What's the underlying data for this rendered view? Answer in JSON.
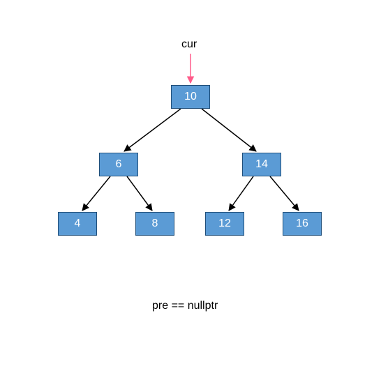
{
  "labels": {
    "cur": "cur",
    "pre": "pre == nullptr"
  },
  "nodes": {
    "root": "10",
    "l": "6",
    "r": "14",
    "ll": "4",
    "lr": "8",
    "rl": "12",
    "rr": "16"
  },
  "chart_data": {
    "type": "tree",
    "title": "",
    "pointer_label": "cur",
    "status_text": "pre == nullptr",
    "nodes": [
      {
        "id": "n10",
        "value": 10,
        "children": [
          "n6",
          "n14"
        ]
      },
      {
        "id": "n6",
        "value": 6,
        "children": [
          "n4",
          "n8"
        ]
      },
      {
        "id": "n14",
        "value": 14,
        "children": [
          "n12",
          "n16"
        ]
      },
      {
        "id": "n4",
        "value": 4,
        "children": []
      },
      {
        "id": "n8",
        "value": 8,
        "children": []
      },
      {
        "id": "n12",
        "value": 12,
        "children": []
      },
      {
        "id": "n16",
        "value": 16,
        "children": []
      }
    ],
    "root": "n10",
    "cur": "n10",
    "pre": null
  }
}
